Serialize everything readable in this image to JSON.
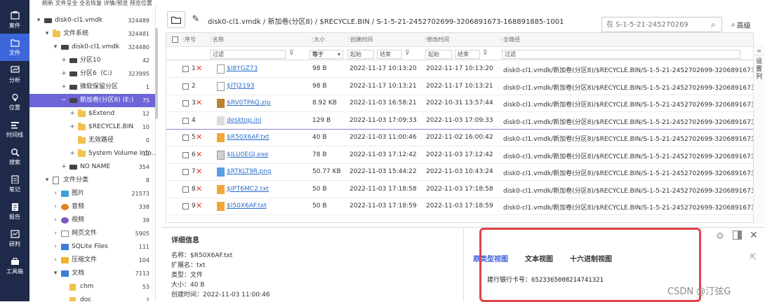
{
  "top_menu": [
    "刷新",
    "文件呈全",
    "全名恢复",
    "详情/预览",
    "预览位置"
  ],
  "left_nav": [
    {
      "icon": "case-icon",
      "label": "案件",
      "active": false
    },
    {
      "icon": "file-icon",
      "label": "文件",
      "active": true
    },
    {
      "icon": "analysis-icon",
      "label": "分析",
      "active": false
    },
    {
      "icon": "location-icon",
      "label": "位置",
      "active": false
    },
    {
      "icon": "timeline-icon",
      "label": "时间线",
      "active": false
    },
    {
      "icon": "search-icon",
      "label": "搜索",
      "active": false
    },
    {
      "icon": "notes-icon",
      "label": "笔记",
      "active": false
    },
    {
      "icon": "report-icon",
      "label": "报告",
      "active": false
    },
    {
      "icon": "research-icon",
      "label": "研判",
      "active": false
    },
    {
      "icon": "toolbox-icon",
      "label": "工具箱",
      "active": false
    }
  ],
  "tree": [
    {
      "label": "disk0-cl1.vmdk",
      "count": "324489",
      "indent": 0,
      "tw": "▾",
      "icon": "disk"
    },
    {
      "label": "文件系统",
      "count": "324481",
      "indent": 1,
      "tw": "▾",
      "icon": "folder"
    },
    {
      "label": "disk0-cl1.vmdk",
      "count": "324480",
      "indent": 2,
      "tw": "▾",
      "icon": "disk"
    },
    {
      "label": "分区10",
      "count": "42",
      "indent": 3,
      "tw": "+",
      "icon": "disk"
    },
    {
      "label": "分区6（C:)",
      "count": "323995",
      "indent": 3,
      "tw": "+",
      "icon": "disk"
    },
    {
      "label": "微软保留分区",
      "count": "1",
      "indent": 3,
      "tw": "+",
      "icon": "disk"
    },
    {
      "label": "新加卷(分区8) (E:)",
      "count": "75",
      "indent": 3,
      "tw": "−",
      "icon": "disk",
      "selected": true
    },
    {
      "label": "$Extend",
      "count": "12",
      "indent": 4,
      "tw": "+",
      "icon": "folder"
    },
    {
      "label": "$RECYCLE.BIN",
      "count": "10",
      "indent": 4,
      "tw": "+",
      "icon": "folder"
    },
    {
      "label": "无效路径",
      "count": "0",
      "indent": 4,
      "tw": "",
      "icon": "folder"
    },
    {
      "label": "System Volume Info...",
      "count": "12",
      "indent": 4,
      "tw": "+",
      "icon": "folder"
    },
    {
      "label": "NO NAME",
      "count": "354",
      "indent": 3,
      "tw": "+",
      "icon": "disk"
    },
    {
      "label": "文件分类",
      "count": "8",
      "indent": 1,
      "tw": "▾",
      "icon": "doc"
    },
    {
      "label": "图片",
      "count": "21573",
      "indent": 2,
      "tw": "›",
      "icon": "img"
    },
    {
      "label": "音频",
      "count": "338",
      "indent": 2,
      "tw": "›",
      "icon": "music"
    },
    {
      "label": "视频",
      "count": "39",
      "indent": 2,
      "tw": "›",
      "icon": "vid"
    },
    {
      "label": "网页文件",
      "count": "5905",
      "indent": 2,
      "tw": "›",
      "icon": "web"
    },
    {
      "label": "SQLite Files",
      "count": "111",
      "indent": 2,
      "tw": "›",
      "icon": "sql"
    },
    {
      "label": "压缩文件",
      "count": "104",
      "indent": 2,
      "tw": "›",
      "icon": "zip"
    },
    {
      "label": "文档",
      "count": "7113",
      "indent": 2,
      "tw": "▾",
      "icon": "docs"
    },
    {
      "label": "chm",
      "count": "53",
      "indent": 3,
      "tw": "",
      "icon": "file"
    },
    {
      "label": "doc",
      "count": "2",
      "indent": 3,
      "tw": "",
      "icon": "file"
    }
  ],
  "path": {
    "segments": [
      "disk0-cl1.vmdk",
      "新加卷(分区8)",
      "$RECYCLE.BIN",
      "S-1-5-21-2452702699-3206891673-168891885-1001"
    ],
    "separator": " / "
  },
  "search_placeholder": "在 S-1-5-21-245270269",
  "advanced_label": "高级",
  "columns": {
    "num": "序号",
    "name": "名称",
    "size": "大小",
    "created": "创建时间",
    "modified": "修改时间",
    "path": "全路径"
  },
  "filters": {
    "name": "过滤",
    "size_op": "等于",
    "start": "起始",
    "end": "结束",
    "path": "过滤"
  },
  "settings_col_label": "设置列",
  "rows": [
    {
      "num": "1",
      "deleted": true,
      "icon": "doc",
      "name": "$I8YGZ73",
      "size": "98 B",
      "created": "2022-11-17 10:13:20",
      "modified": "2022-11-17 10:13:20",
      "path": "disk0-cl1.vmdk/新加卷(分区8)/$RECYCLE.BIN/S-1-5-21-2452702699-3206891673-16"
    },
    {
      "num": "2",
      "deleted": false,
      "icon": "doc",
      "name": "$ITJ2193",
      "size": "98 B",
      "created": "2022-11-17 10:13:21",
      "modified": "2022-11-17 10:13:21",
      "path": "disk0-cl1.vmdk/新加卷(分区8)/$RECYCLE.BIN/S-1-5-21-2452702699-3206891673-16"
    },
    {
      "num": "3",
      "deleted": true,
      "icon": "zip",
      "name": "$RV0TPAQ.zip",
      "size": "8.92 KB",
      "created": "2022-11-03 16:58:21",
      "modified": "2022-10-31 13:57:44",
      "path": "disk0-cl1.vmdk/新加卷(分区8)/$RECYCLE.BIN/S-1-5-21-2452702699-3206891673-16"
    },
    {
      "num": "4",
      "deleted": false,
      "icon": "lite",
      "name": "desktop.ini",
      "size": "129 B",
      "created": "2022-11-03 17:09:33",
      "modified": "2022-11-03 17:09:33",
      "path": "disk0-cl1.vmdk/新加卷(分区8)/$RECYCLE.BIN/S-1-5-21-2452702699-3206891673-16",
      "highlight": true
    },
    {
      "num": "5",
      "deleted": true,
      "icon": "orange",
      "name": "$R50X6AF.txt",
      "size": "40 B",
      "created": "2022-11-03 11:00:46",
      "modified": "2022-11-02 16:00:42",
      "path": "disk0-cl1.vmdk/新加卷(分区8)/$RECYCLE.BIN/S-1-5-21-2452702699-3206891673-16"
    },
    {
      "num": "6",
      "deleted": true,
      "icon": "exe",
      "name": "$ILU0EGJ.exe",
      "size": "78 B",
      "created": "2022-11-03 17:12:42",
      "modified": "2022-11-03 17:12:42",
      "path": "disk0-cl1.vmdk/新加卷(分区8)/$RECYCLE.BIN/S-1-5-21-2452702699-3206891673-16"
    },
    {
      "num": "7",
      "deleted": true,
      "icon": "png",
      "name": "$RTKLT9R.png",
      "size": "50.77 KB",
      "created": "2022-11-03 15:44:22",
      "modified": "2022-11-03 10:43:24",
      "path": "disk0-cl1.vmdk/新加卷(分区8)/$RECYCLE.BIN/S-1-5-21-2452702699-3206891673-16"
    },
    {
      "num": "8",
      "deleted": true,
      "icon": "orange",
      "name": "$IPT6MC2.txt",
      "size": "50 B",
      "created": "2022-11-03 17:18:58",
      "modified": "2022-11-03 17:18:58",
      "path": "disk0-cl1.vmdk/新加卷(分区8)/$RECYCLE.BIN/S-1-5-21-2452702699-3206891673-16"
    },
    {
      "num": "9",
      "deleted": true,
      "icon": "orange",
      "name": "$I50X6AF.txt",
      "size": "50 B",
      "created": "2022-11-03 17:18:59",
      "modified": "2022-11-03 17:18:59",
      "path": "disk0-cl1.vmdk/新加卷(分区8)/$RECYCLE.BIN/S-1-5-21-2452702699-3206891673-16"
    }
  ],
  "details": {
    "title": "详细信息",
    "lines": [
      "名称：$R50X6AF.txt",
      "扩展名：txt",
      "类型：文件",
      "大小：40 B",
      "创建时间：2022-11-03 11:00:46"
    ],
    "tabs": [
      "原类型视图",
      "文本视图",
      "十六进制视图"
    ],
    "content": "建行银行卡号：6523365008214741321"
  },
  "watermark": "CSDN @汀弦G",
  "colors": {
    "nav_bg": "#1f2a4a",
    "nav_active": "#3c66d9",
    "tree_selected": "#6d64d7",
    "link": "#2a6fc9",
    "delete_mark": "#e33",
    "red_box": "#e0444c",
    "tab_active": "#3b5bd8"
  }
}
